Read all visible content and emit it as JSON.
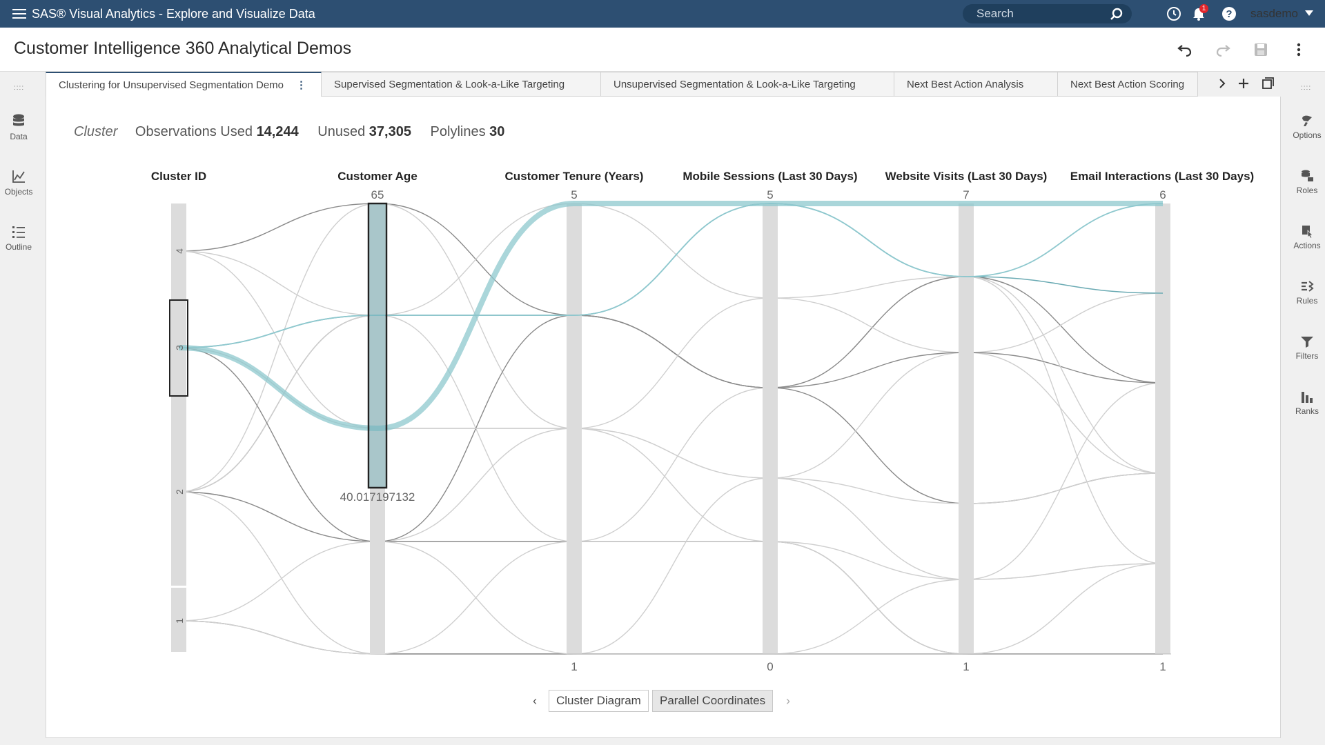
{
  "app": {
    "title": "SAS® Visual Analytics - Explore and Visualize Data"
  },
  "topbar": {
    "search_placeholder": "Search",
    "notification_count": "1",
    "user": "sasdemo"
  },
  "report": {
    "title": "Customer Intelligence 360 Analytical Demos"
  },
  "left_rail": [
    {
      "label": "Data"
    },
    {
      "label": "Objects"
    },
    {
      "label": "Outline"
    }
  ],
  "right_rail": [
    {
      "label": "Options"
    },
    {
      "label": "Roles"
    },
    {
      "label": "Actions"
    },
    {
      "label": "Rules"
    },
    {
      "label": "Filters"
    },
    {
      "label": "Ranks"
    }
  ],
  "tabs": [
    {
      "label": "Clustering for Unsupervised Segmentation Demo",
      "active": true
    },
    {
      "label": "Supervised Segmentation & Look-a-Like Targeting"
    },
    {
      "label": "Unsupervised Segmentation & Look-a-Like Targeting"
    },
    {
      "label": "Next Best Action Analysis"
    },
    {
      "label": "Next Best Action Scoring"
    }
  ],
  "stats": {
    "cluster_label": "Cluster",
    "observations_label": "Observations Used",
    "observations_value": "14,244",
    "unused_label": "Unused",
    "unused_value": "37,305",
    "polylines_label": "Polylines",
    "polylines_value": "30"
  },
  "chart_data": {
    "type": "parallel-coordinates",
    "axes": [
      {
        "name": "Cluster ID",
        "type": "categorical",
        "categories": [
          "4",
          "3",
          "2",
          "1"
        ],
        "selected": "3"
      },
      {
        "name": "Customer Age",
        "min_label": "40.017197132",
        "max_label": "65",
        "selected_range": [
          40.017197132,
          65
        ]
      },
      {
        "name": "Customer Tenure (Years)",
        "min_label": "1",
        "max_label": "5"
      },
      {
        "name": "Mobile Sessions (Last 30 Days)",
        "min_label": "0",
        "max_label": "5"
      },
      {
        "name": "Website Visits (Last 30 Days)",
        "min_label": "1",
        "max_label": "7"
      },
      {
        "name": "Email Interactions (Last 30 Days)",
        "min_label": "1",
        "max_label": "6"
      }
    ],
    "colors": {
      "selected": "#8ec8ce",
      "highlight": "#6aaab3",
      "gray_dark": "#8a8a8a",
      "gray_light": "#cfcfcf"
    }
  },
  "pager": {
    "items": [
      "Cluster Diagram",
      "Parallel Coordinates"
    ],
    "selected": "Parallel Coordinates"
  }
}
